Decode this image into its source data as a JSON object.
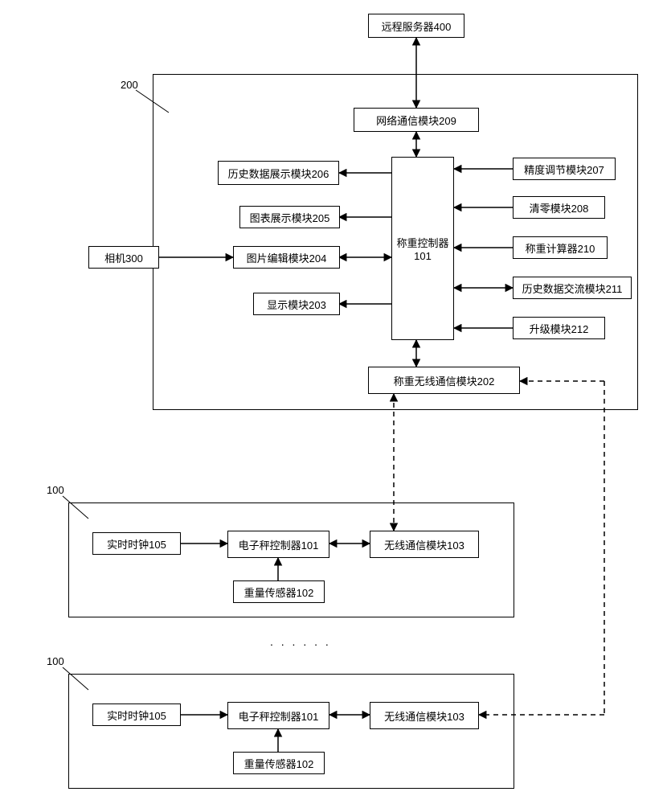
{
  "remoteServer": "远程服务器400",
  "container200": "200",
  "container100a": "100",
  "container100b": "100",
  "camera": "相机300",
  "netComm": "网络通信模块209",
  "histDisplay": "历史数据展示模块206",
  "chartDisplay": "图表展示模块205",
  "imgEdit": "图片编辑模块204",
  "display": "显示模块203",
  "weighController": "称重控制器\n101",
  "precision": "精度调节模块207",
  "zero": "清零模块208",
  "weighCalc": "称重计算器210",
  "histExchange": "历史数据交流模块211",
  "upgrade": "升级模块212",
  "weighWireless": "称重无线通信模块202",
  "rtc1": "实时时钟105",
  "scaleCtrl1": "电子秤控制器101",
  "wireless1": "无线通信模块103",
  "weightSensor1": "重量传感器102",
  "rtc2": "实时时钟105",
  "scaleCtrl2": "电子秤控制器101",
  "wireless2": "无线通信模块103",
  "weightSensor2": "重量传感器102",
  "ellipsis": ". . . . . ."
}
